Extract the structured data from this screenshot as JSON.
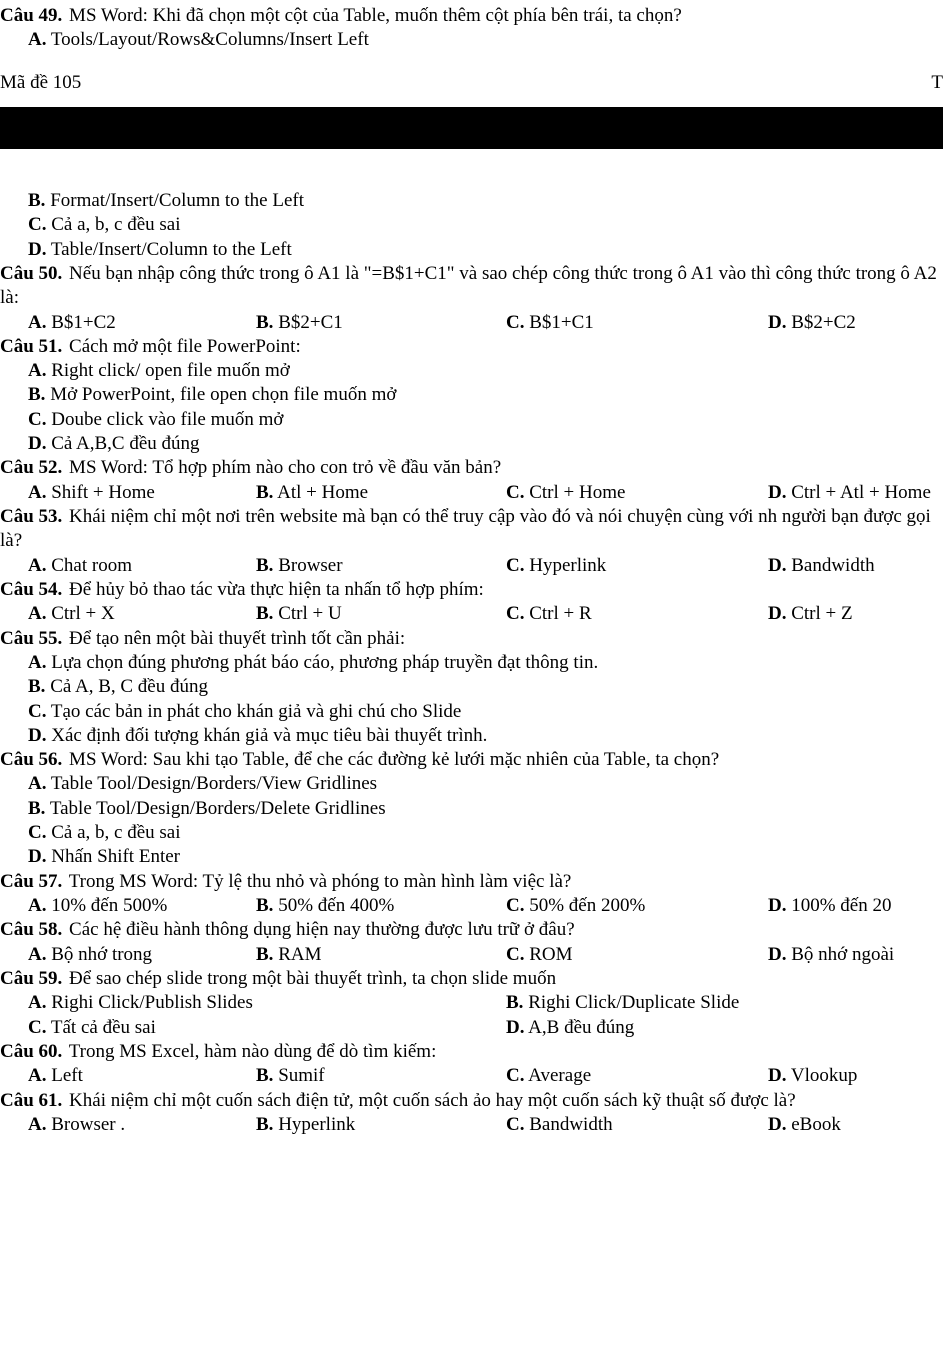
{
  "header": {
    "exam_code_label": "Mã đề 105",
    "right_marker": "T"
  },
  "q49": {
    "label": "Câu 49.",
    "text": " MS Word: Khi đã chọn một cột của Table, muốn thêm cột phía bên trái, ta chọn?",
    "A": {
      "l": "A.",
      "t": " Tools/Layout/Rows&Columns/Insert Left"
    },
    "B": {
      "l": "B.",
      "t": " Format/Insert/Column to the Left"
    },
    "C": {
      "l": "C.",
      "t": " Cả a, b, c đều sai"
    },
    "D": {
      "l": "D.",
      "t": " Table/Insert/Column to the Left"
    }
  },
  "q50": {
    "label": "Câu 50.",
    "text": " Nếu bạn nhập công thức trong ô A1 là \"=B$1+C1\" và sao chép công thức trong ô A1 vào  thì công thức trong ô A2 là:",
    "A": {
      "l": "A.",
      "t": " B$1+C2"
    },
    "B": {
      "l": "B.",
      "t": " B$2+C1"
    },
    "C": {
      "l": "C.",
      "t": " B$1+C1"
    },
    "D": {
      "l": "D.",
      "t": " B$2+C2"
    }
  },
  "q51": {
    "label": "Câu 51.",
    "text": " Cách mở một file PowerPoint:",
    "A": {
      "l": "A.",
      "t": " Right click/ open file muốn mở"
    },
    "B": {
      "l": "B.",
      "t": " Mở PowerPoint, file open chọn file muốn mở"
    },
    "C": {
      "l": "C.",
      "t": " Doube click vào file muốn mở"
    },
    "D": {
      "l": "D.",
      "t": " Cả A,B,C đều đúng"
    }
  },
  "q52": {
    "label": "Câu 52.",
    "text": " MS Word: Tổ hợp phím nào cho con trỏ về đầu văn bản?",
    "A": {
      "l": "A.",
      "t": " Shift + Home"
    },
    "B": {
      "l": "B.",
      "t": " Atl + Home"
    },
    "C": {
      "l": "C.",
      "t": " Ctrl + Home"
    },
    "D": {
      "l": "D.",
      "t": " Ctrl + Atl + Home"
    }
  },
  "q53": {
    "label": "Câu 53.",
    "text": " Khái niệm chỉ một nơi trên website mà bạn có thể truy cập vào đó và nói chuyện cùng với nh người bạn được gọi là?",
    "A": {
      "l": "A.",
      "t": " Chat room"
    },
    "B": {
      "l": "B.",
      "t": " Browser"
    },
    "C": {
      "l": "C.",
      "t": " Hyperlink"
    },
    "D": {
      "l": "D.",
      "t": " Bandwidth"
    }
  },
  "q54": {
    "label": "Câu 54.",
    "text": " Để hủy bỏ thao tác vừa thực hiện ta nhấn tổ hợp phím:",
    "A": {
      "l": "A.",
      "t": " Ctrl + X"
    },
    "B": {
      "l": "B.",
      "t": " Ctrl + U"
    },
    "C": {
      "l": "C.",
      "t": " Ctrl + R"
    },
    "D": {
      "l": "D.",
      "t": " Ctrl + Z"
    }
  },
  "q55": {
    "label": "Câu 55.",
    "text": " Để tạo nên một bài thuyết trình tốt cần phải:",
    "A": {
      "l": "A.",
      "t": " Lựa chọn đúng phương phát báo cáo, phương pháp truyền đạt thông tin."
    },
    "B": {
      "l": "B.",
      "t": " Cả A, B, C đều đúng"
    },
    "C": {
      "l": "C.",
      "t": " Tạo các bản in phát cho khán giả và ghi chú cho Slide"
    },
    "D": {
      "l": "D.",
      "t": " Xác định đối tượng khán giả và mục tiêu bài thuyết trình."
    }
  },
  "q56": {
    "label": "Câu 56.",
    "text": " MS Word: Sau khi tạo Table, để che các đường kẻ lưới mặc nhiên của Table, ta chọn?",
    "A": {
      "l": "A.",
      "t": " Table Tool/Design/Borders/View Gridlines"
    },
    "B": {
      "l": "B.",
      "t": " Table Tool/Design/Borders/Delete Gridlines"
    },
    "C": {
      "l": "C.",
      "t": " Cả a, b, c đều sai"
    },
    "D": {
      "l": "D.",
      "t": " Nhấn Shift Enter"
    }
  },
  "q57": {
    "label": "Câu 57.",
    "text": " Trong MS Word: Tỷ lệ thu nhỏ và phóng to màn hình làm việc là?",
    "A": {
      "l": "A.",
      "t": " 10% đến 500%"
    },
    "B": {
      "l": "B.",
      "t": " 50% đến 400%"
    },
    "C": {
      "l": "C.",
      "t": " 50% đến 200%"
    },
    "D": {
      "l": "D.",
      "t": " 100% đến 20"
    }
  },
  "q58": {
    "label": "Câu 58.",
    "text": " Các hệ điều hành thông dụng hiện nay thường được lưu trữ ở đâu?",
    "A": {
      "l": "A.",
      "t": " Bộ nhớ trong"
    },
    "B": {
      "l": "B.",
      "t": " RAM"
    },
    "C": {
      "l": "C.",
      "t": " ROM"
    },
    "D": {
      "l": "D.",
      "t": " Bộ nhớ ngoài"
    }
  },
  "q59": {
    "label": "Câu 59.",
    "text": " Để sao chép slide trong một bài thuyết trình, ta chọn slide muốn",
    "A": {
      "l": "A.",
      "t": " Righi Click/Publish Slides"
    },
    "B": {
      "l": "B.",
      "t": " Righi Click/Duplicate Slide"
    },
    "C": {
      "l": "C.",
      "t": " Tất cả đều sai"
    },
    "D": {
      "l": "D.",
      "t": " A,B đều đúng"
    }
  },
  "q60": {
    "label": "Câu 60.",
    "text": " Trong MS Excel, hàm nào dùng để dò tìm kiếm:",
    "A": {
      "l": "A.",
      "t": " Left"
    },
    "B": {
      "l": "B.",
      "t": " Sumif"
    },
    "C": {
      "l": "C.",
      "t": " Average"
    },
    "D": {
      "l": "D.",
      "t": " Vlookup"
    }
  },
  "q61": {
    "label": "Câu 61.",
    "text": " Khái niệm chỉ một cuốn sách điện tử, một cuốn sách ảo hay một cuốn sách kỹ thuật số được là?",
    "A": {
      "l": "A.",
      "t": " Browser ."
    },
    "B": {
      "l": "B.",
      "t": " Hyperlink"
    },
    "C": {
      "l": "C.",
      "t": " Bandwidth"
    },
    "D": {
      "l": "D.",
      "t": " eBook"
    }
  }
}
